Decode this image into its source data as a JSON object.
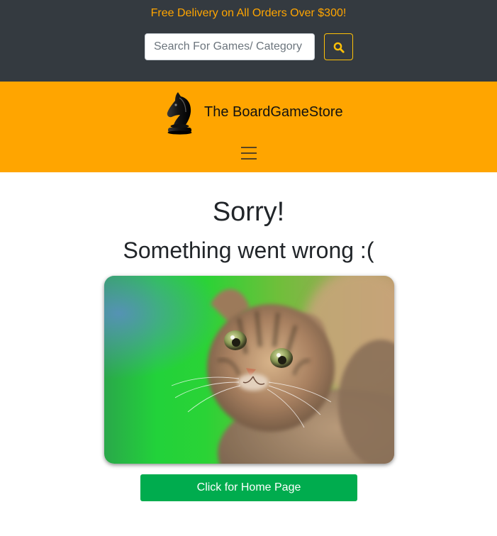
{
  "header": {
    "promo_text": "Free Delivery on All Orders Over $300!",
    "search": {
      "placeholder": "Search For Games/ Category",
      "value": "",
      "button_icon": "search-icon"
    }
  },
  "brand": {
    "name": "The BoardGameStore",
    "logo_icon": "chess-knight-icon",
    "menu_icon": "hamburger-menu-icon"
  },
  "error": {
    "title": "Sorry!",
    "subtitle": "Something went wrong :(",
    "image": "sad-kitten-photo",
    "home_button_label": "Click for Home Page"
  },
  "colors": {
    "topbar": "#343a40",
    "promo": "#ffa500",
    "brand_bar": "#ffa500",
    "search_button_border": "#ffc107",
    "home_button": "#00ac4e"
  }
}
